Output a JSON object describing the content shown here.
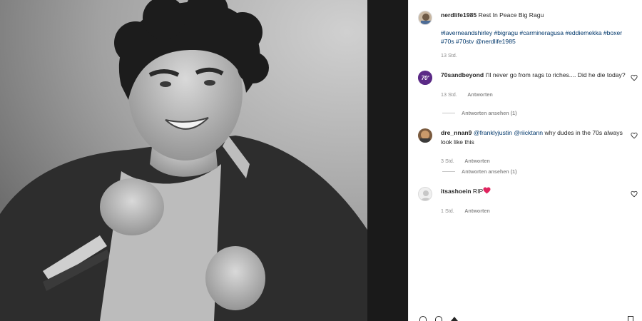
{
  "post": {
    "author": "nerdlife1985",
    "caption_text": "Rest In Peace Big Ragu",
    "hashtags_line1": "#laverneandshirley #bigragu #carmineragusa #eddiemekka #boxer",
    "hashtags_line2": "#70s #70stv @nerdlife1985",
    "timestamp": "13 Std."
  },
  "comments": [
    {
      "username": "70sandbeyond",
      "text": "I'll never go from rags to riches.... Did he die today?",
      "time": "13 Std.",
      "reply_label": "Antworten",
      "view_replies": "Antworten ansehen (1)"
    },
    {
      "username": "dre_nnan9",
      "mention1": "@franklyjustin",
      "mention2": "@riicktann",
      "text": "why dudes in the 70s always look like this",
      "time": "3 Std.",
      "reply_label": "Antworten",
      "view_replies": "Antworten ansehen (1)"
    },
    {
      "username": "itsashoein",
      "text": "RIP",
      "time": "1 Std.",
      "reply_label": "Antworten"
    }
  ],
  "icons": {
    "like": "heart-icon",
    "avatar_badge": "70s-badge-icon"
  },
  "colors": {
    "link": "#00376b",
    "muted": "#8e8e8e",
    "heart_red": "#ed4956",
    "badge_purple": "#5b2a86"
  }
}
